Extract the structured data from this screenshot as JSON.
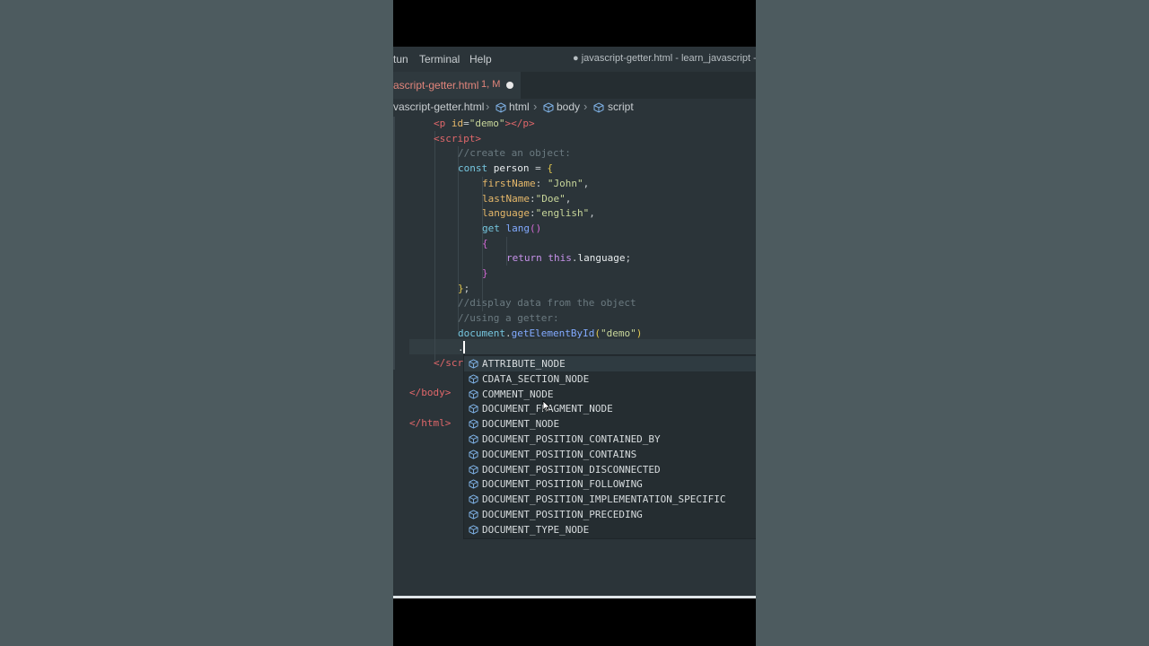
{
  "menubar": {
    "items": [
      "Run",
      "Terminal",
      "Help"
    ],
    "run_visible": "tun",
    "window_title": "● javascript-getter.html - learn_javascript - V"
  },
  "tab": {
    "name": "javascript-getter.html",
    "name_visible": "ascript-getter.html",
    "badge": "1, M"
  },
  "breadcrumb": {
    "file": "vascript-getter.html",
    "items": [
      "html",
      "body",
      "script"
    ]
  },
  "code": {
    "p_line": {
      "tag": "p",
      "attr": "id",
      "value": "\"demo\"",
      "close": "p"
    },
    "script_open": "script",
    "comment1": "//create an object:",
    "const_kw": "const",
    "person": "person",
    "firstName": "firstName",
    "firstName_val": "\"John\"",
    "lastName": "lastName",
    "lastName_val": "\"Doe\"",
    "language": "language",
    "language_val": "\"english\"",
    "get_kw": "get",
    "lang": "lang",
    "return_kw": "return",
    "this_kw": "this",
    "return_prop": "language",
    "comment2": "//display data from the object",
    "comment3": "//using a getter:",
    "document": "document",
    "method": "getElementById",
    "arg": "\"demo\"",
    "script_close_visible": "scr",
    "body_close": "body",
    "html_close": "html"
  },
  "suggestions": [
    "ATTRIBUTE_NODE",
    "CDATA_SECTION_NODE",
    "COMMENT_NODE",
    "DOCUMENT_FRAGMENT_NODE",
    "DOCUMENT_NODE",
    "DOCUMENT_POSITION_CONTAINED_BY",
    "DOCUMENT_POSITION_CONTAINS",
    "DOCUMENT_POSITION_DISCONNECTED",
    "DOCUMENT_POSITION_FOLLOWING",
    "DOCUMENT_POSITION_IMPLEMENTATION_SPECIFIC",
    "DOCUMENT_POSITION_PRECEDING",
    "DOCUMENT_TYPE_NODE"
  ],
  "icons": {
    "suggestion_icon": "cube-icon",
    "breadcrumb_icon": "cube-icon"
  },
  "colors": {
    "tab_modified": "#e2857b",
    "tag": "#e0676a",
    "string": "#c8d69a",
    "keyword": "#76c7e0",
    "background": "#2b3439"
  }
}
